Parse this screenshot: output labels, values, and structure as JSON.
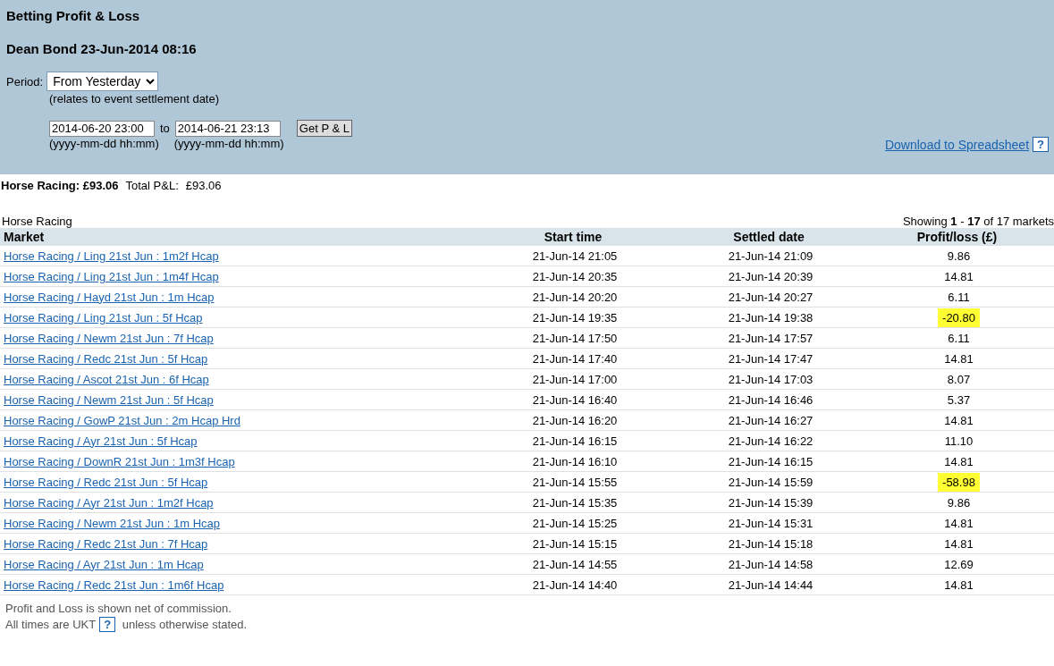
{
  "header": {
    "title": "Betting Profit & Loss",
    "subtitle": "Dean Bond 23-Jun-2014 08:16",
    "period_label": "Period:",
    "period_value": "From Yesterday",
    "period_note": "(relates to event settlement date)",
    "from_value": "2014-06-20 23:00",
    "to_label": "to",
    "to_value": "2014-06-21 23:13",
    "button": "Get P & L",
    "from_hint": "(yyyy-mm-dd hh:mm)",
    "to_hint": "(yyyy-mm-dd hh:mm)",
    "download_link": "Download to Spreadsheet",
    "help": "?"
  },
  "summary": {
    "sport_total": "Horse Racing: £93.06",
    "total_label": "Total P&L:",
    "total_value": "£93.06"
  },
  "table": {
    "caption": "Horse Racing",
    "showing": "Showing **1** - **17** of 17 markets",
    "columns": [
      "Market",
      "Start time",
      "Settled date",
      "Profit/loss (£)"
    ],
    "rows": [
      {
        "market": "Horse Racing / Ling 21st Jun : 1m2f Hcap",
        "start": "21-Jun-14 21:05",
        "settled": "21-Jun-14 21:09",
        "pl": "9.86",
        "highlighted": false
      },
      {
        "market": "Horse Racing / Ling 21st Jun : 1m4f Hcap",
        "start": "21-Jun-14 20:35",
        "settled": "21-Jun-14 20:39",
        "pl": "14.81",
        "highlighted": false
      },
      {
        "market": "Horse Racing / Hayd 21st Jun : 1m Hcap",
        "start": "21-Jun-14 20:20",
        "settled": "21-Jun-14 20:27",
        "pl": "6.11",
        "highlighted": false
      },
      {
        "market": "Horse Racing / Ling 21st Jun : 5f Hcap",
        "start": "21-Jun-14 19:35",
        "settled": "21-Jun-14 19:38",
        "pl": "-20.80",
        "highlighted": true
      },
      {
        "market": "Horse Racing / Newm 21st Jun : 7f Hcap",
        "start": "21-Jun-14 17:50",
        "settled": "21-Jun-14 17:57",
        "pl": "6.11",
        "highlighted": false
      },
      {
        "market": "Horse Racing / Redc 21st Jun : 5f Hcap",
        "start": "21-Jun-14 17:40",
        "settled": "21-Jun-14 17:47",
        "pl": "14.81",
        "highlighted": false
      },
      {
        "market": "Horse Racing / Ascot 21st Jun : 6f Hcap",
        "start": "21-Jun-14 17:00",
        "settled": "21-Jun-14 17:03",
        "pl": "8.07",
        "highlighted": false
      },
      {
        "market": "Horse Racing / Newm 21st Jun : 5f Hcap",
        "start": "21-Jun-14 16:40",
        "settled": "21-Jun-14 16:46",
        "pl": "5.37",
        "highlighted": false
      },
      {
        "market": "Horse Racing / GowP 21st Jun : 2m Hcap Hrd",
        "start": "21-Jun-14 16:20",
        "settled": "21-Jun-14 16:27",
        "pl": "14.81",
        "highlighted": false
      },
      {
        "market": "Horse Racing / Ayr 21st Jun : 5f Hcap",
        "start": "21-Jun-14 16:15",
        "settled": "21-Jun-14 16:22",
        "pl": "11.10",
        "highlighted": false
      },
      {
        "market": "Horse Racing / DownR 21st Jun : 1m3f Hcap",
        "start": "21-Jun-14 16:10",
        "settled": "21-Jun-14 16:15",
        "pl": "14.81",
        "highlighted": false
      },
      {
        "market": "Horse Racing / Redc 21st Jun : 5f Hcap",
        "start": "21-Jun-14 15:55",
        "settled": "21-Jun-14 15:59",
        "pl": "-58.98",
        "highlighted": true
      },
      {
        "market": "Horse Racing / Ayr 21st Jun : 1m2f Hcap",
        "start": "21-Jun-14 15:35",
        "settled": "21-Jun-14 15:39",
        "pl": "9.86",
        "highlighted": false
      },
      {
        "market": "Horse Racing / Newm 21st Jun : 1m Hcap",
        "start": "21-Jun-14 15:25",
        "settled": "21-Jun-14 15:31",
        "pl": "14.81",
        "highlighted": false
      },
      {
        "market": "Horse Racing / Redc 21st Jun : 7f Hcap",
        "start": "21-Jun-14 15:15",
        "settled": "21-Jun-14 15:18",
        "pl": "14.81",
        "highlighted": false
      },
      {
        "market": "Horse Racing / Ayr 21st Jun : 1m Hcap",
        "start": "21-Jun-14 14:55",
        "settled": "21-Jun-14 14:58",
        "pl": "12.69",
        "highlighted": false
      },
      {
        "market": "Horse Racing / Redc 21st Jun : 1m6f Hcap",
        "start": "21-Jun-14 14:40",
        "settled": "21-Jun-14 14:44",
        "pl": "14.81",
        "highlighted": false
      }
    ]
  },
  "footer": {
    "line1": "Profit and Loss is shown net of commission.",
    "line2_before": "All times are UKT",
    "help": "?",
    "line2_after": "unless otherwise stated."
  }
}
